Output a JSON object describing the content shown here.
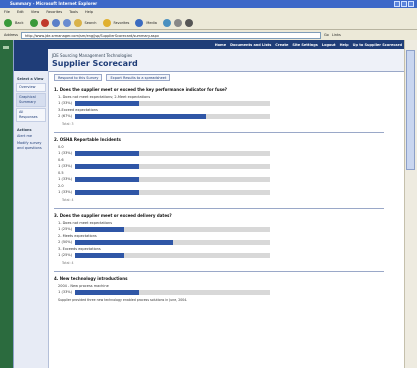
{
  "window": {
    "title": "Summary - Microsoft Internet Explorer"
  },
  "menu": {
    "items": [
      "File",
      "Edit",
      "View",
      "Favorites",
      "Tools",
      "Help"
    ]
  },
  "toolbar": {
    "back_label": "Back",
    "search_label": "Search",
    "favorites_label": "Favorites",
    "media_label": "Media"
  },
  "address": {
    "label": "Address",
    "url": "http://www.jde-srmanager.com/sm/eng/jsp/SupplierScorecard/summary.aspx",
    "go_label": "Go",
    "links_label": "Links"
  },
  "topnav": {
    "items": [
      "Home",
      "Documents and Lists",
      "Create",
      "Site Settings",
      "Logout",
      "Help",
      "Up to Supplier Scorecard"
    ]
  },
  "header": {
    "org": "JDE Sourcing Management Technologies",
    "title": "Supplier Scorecard"
  },
  "sidebar": {
    "heading": "Select a View",
    "views": [
      {
        "label": "Overview",
        "active": false
      },
      {
        "label": "Graphical Summary",
        "active": true
      },
      {
        "label": "All Responses",
        "active": false
      }
    ],
    "actions_heading": "Actions",
    "actions": [
      "Alert me",
      "Modify survey and questions"
    ]
  },
  "main": {
    "actions": [
      "Respond to this Survey",
      "Export Results to a spreadsheet"
    ],
    "questions": [
      {
        "title": "1. Does the supplier meet or exceed the key performance indicator for fuse?",
        "options": [
          {
            "label": "1- Does not meet expectations; 2-Meet expectations",
            "pct": "1 (33%)",
            "fraction": 0.33
          },
          {
            "label": "3-Exceed expectations",
            "pct": "2 (67%)",
            "fraction": 0.67
          }
        ],
        "total": "Total: 3"
      },
      {
        "title": "2. OSHA Reportable Incidents",
        "options": [
          {
            "label": "0.0",
            "pct": "1 (33%)",
            "fraction": 0.33
          },
          {
            "label": "0.6",
            "pct": "1 (33%)",
            "fraction": 0.33
          },
          {
            "label": "0.5",
            "pct": "1 (33%)",
            "fraction": 0.33
          },
          {
            "label": "2.0",
            "pct": "1 (33%)",
            "fraction": 0.33
          }
        ],
        "total": "Total: 4"
      },
      {
        "title": "3. Does the supplier meet or exceed delivery dates?",
        "options": [
          {
            "label": "1- Does not meet expectations",
            "pct": "1 (25%)",
            "fraction": 0.25
          },
          {
            "label": "2- Meets expectations",
            "pct": "2 (50%)",
            "fraction": 0.5
          },
          {
            "label": "3- Exceeds expectations",
            "pct": "1 (25%)",
            "fraction": 0.25
          }
        ],
        "total": "Total: 4"
      },
      {
        "title": "4. New technology introductions",
        "options": [
          {
            "label": "2004 - New process machine",
            "pct": "1 (33%)",
            "fraction": 0.33
          }
        ],
        "total": ""
      }
    ],
    "note": "Supplier provided three new technology enabled process solutions in June, 2004."
  }
}
